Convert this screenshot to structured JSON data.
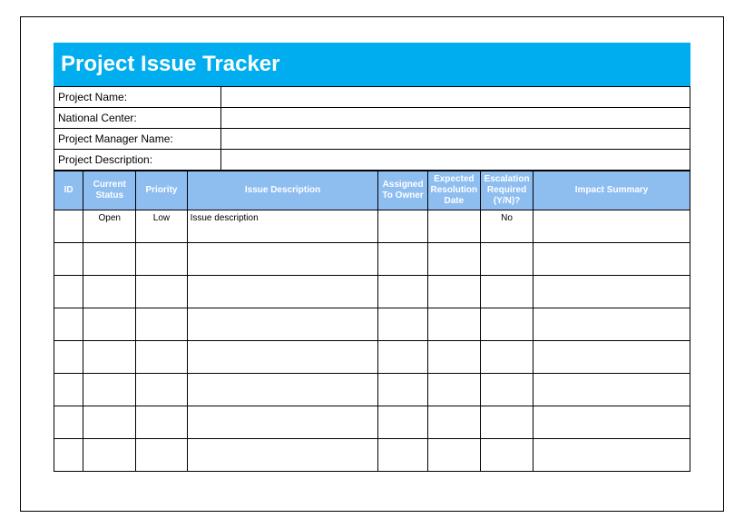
{
  "title": "Project Issue Tracker",
  "info_rows": [
    {
      "label": "Project Name:",
      "value": ""
    },
    {
      "label": "National Center:",
      "value": ""
    },
    {
      "label": "Project Manager Name:",
      "value": ""
    },
    {
      "label": "Project Description:",
      "value": ""
    }
  ],
  "columns": [
    "ID",
    "Current Status",
    "Priority",
    "Issue Description",
    "Assigned To Owner",
    "Expected Resolution Date",
    "Escalation Required (Y/N)?",
    "Impact Summary"
  ],
  "rows": [
    {
      "id": "",
      "status": "Open",
      "priority": "Low",
      "desc": "Issue description",
      "assigned": "",
      "date": "",
      "escalation": "No",
      "impact": ""
    },
    {
      "id": "",
      "status": "",
      "priority": "",
      "desc": "",
      "assigned": "",
      "date": "",
      "escalation": "",
      "impact": ""
    },
    {
      "id": "",
      "status": "",
      "priority": "",
      "desc": "",
      "assigned": "",
      "date": "",
      "escalation": "",
      "impact": ""
    },
    {
      "id": "",
      "status": "",
      "priority": "",
      "desc": "",
      "assigned": "",
      "date": "",
      "escalation": "",
      "impact": ""
    },
    {
      "id": "",
      "status": "",
      "priority": "",
      "desc": "",
      "assigned": "",
      "date": "",
      "escalation": "",
      "impact": ""
    },
    {
      "id": "",
      "status": "",
      "priority": "",
      "desc": "",
      "assigned": "",
      "date": "",
      "escalation": "",
      "impact": ""
    },
    {
      "id": "",
      "status": "",
      "priority": "",
      "desc": "",
      "assigned": "",
      "date": "",
      "escalation": "",
      "impact": ""
    },
    {
      "id": "",
      "status": "",
      "priority": "",
      "desc": "",
      "assigned": "",
      "date": "",
      "escalation": "",
      "impact": ""
    }
  ]
}
